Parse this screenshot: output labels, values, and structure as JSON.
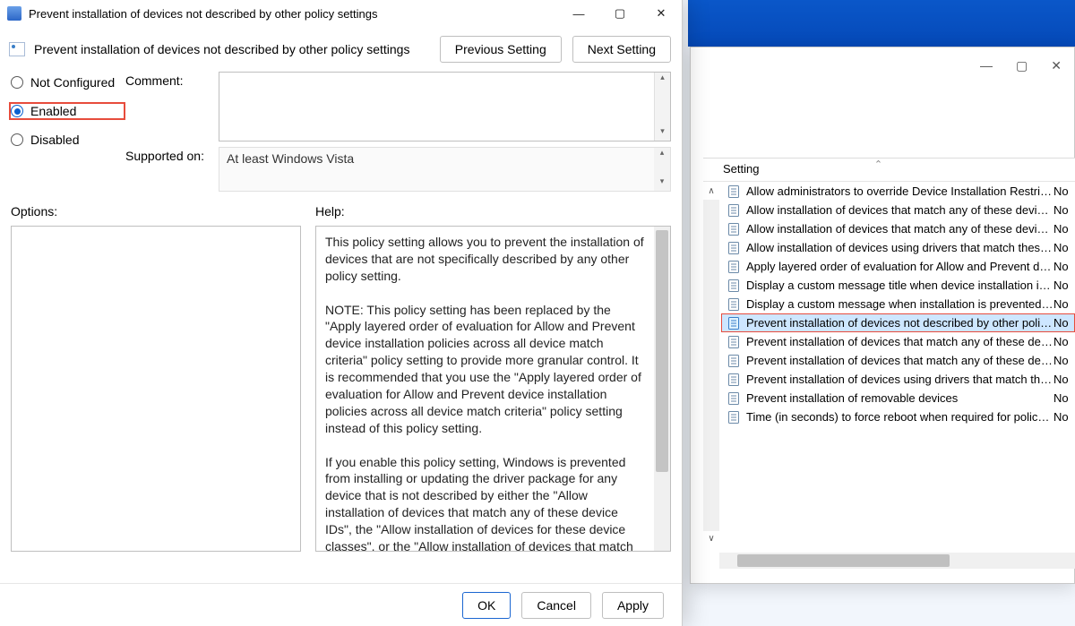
{
  "dialog": {
    "title": "Prevent installation of devices not described by other policy settings",
    "subtitle": "Prevent installation of devices not described by other policy settings",
    "prev_btn": "Previous Setting",
    "next_btn": "Next Setting",
    "radios": {
      "not_configured": "Not Configured",
      "enabled": "Enabled",
      "disabled": "Disabled"
    },
    "comment_label": "Comment:",
    "supported_label": "Supported on:",
    "supported_value": "At least Windows Vista",
    "options_label": "Options:",
    "help_label": "Help:",
    "help_text": "This policy setting allows you to prevent the installation of devices that are not specifically described by any other policy setting.\n\nNOTE: This policy setting has been replaced by the \"Apply layered order of evaluation for Allow and Prevent device installation policies across all device match criteria\" policy setting to provide more granular control. It is recommended that you use the \"Apply layered order of evaluation for Allow and Prevent device installation policies across all device match criteria\" policy setting instead of this policy setting.\n\nIf you enable this policy setting, Windows is prevented from installing or updating the driver package for any device that is not described by either the \"Allow installation of devices that match any of these device IDs\", the \"Allow installation of devices for these device classes\", or the \"Allow installation of devices that match any of these device instance IDs\" policy setting.\n\nIf you disable or do not configure this policy setting, Windows is",
    "footer": {
      "ok": "OK",
      "cancel": "Cancel",
      "apply": "Apply"
    }
  },
  "secondary": {
    "header_setting": "Setting",
    "items": [
      {
        "label": "Allow administrators to override Device Installation Restrictio…",
        "state": "No"
      },
      {
        "label": "Allow installation of devices that match any of these device IDs",
        "state": "No"
      },
      {
        "label": "Allow installation of devices that match any of these device i…",
        "state": "No"
      },
      {
        "label": "Allow installation of devices using drivers that match these d…",
        "state": "No"
      },
      {
        "label": "Apply layered order of evaluation for Allow and Prevent devic…",
        "state": "No"
      },
      {
        "label": "Display a custom message title when device installation is pre…",
        "state": "No"
      },
      {
        "label": "Display a custom message when installation is prevented by …",
        "state": "No"
      },
      {
        "label": "Prevent installation of devices not described by other policy s…",
        "state": "No",
        "selected": true
      },
      {
        "label": "Prevent installation of devices that match any of these device…",
        "state": "No"
      },
      {
        "label": "Prevent installation of devices that match any of these device…",
        "state": "No"
      },
      {
        "label": "Prevent installation of devices using drivers that match these …",
        "state": "No"
      },
      {
        "label": "Prevent installation of removable devices",
        "state": "No"
      },
      {
        "label": "Time (in seconds) to force reboot when required for policy ch…",
        "state": "No"
      }
    ]
  }
}
